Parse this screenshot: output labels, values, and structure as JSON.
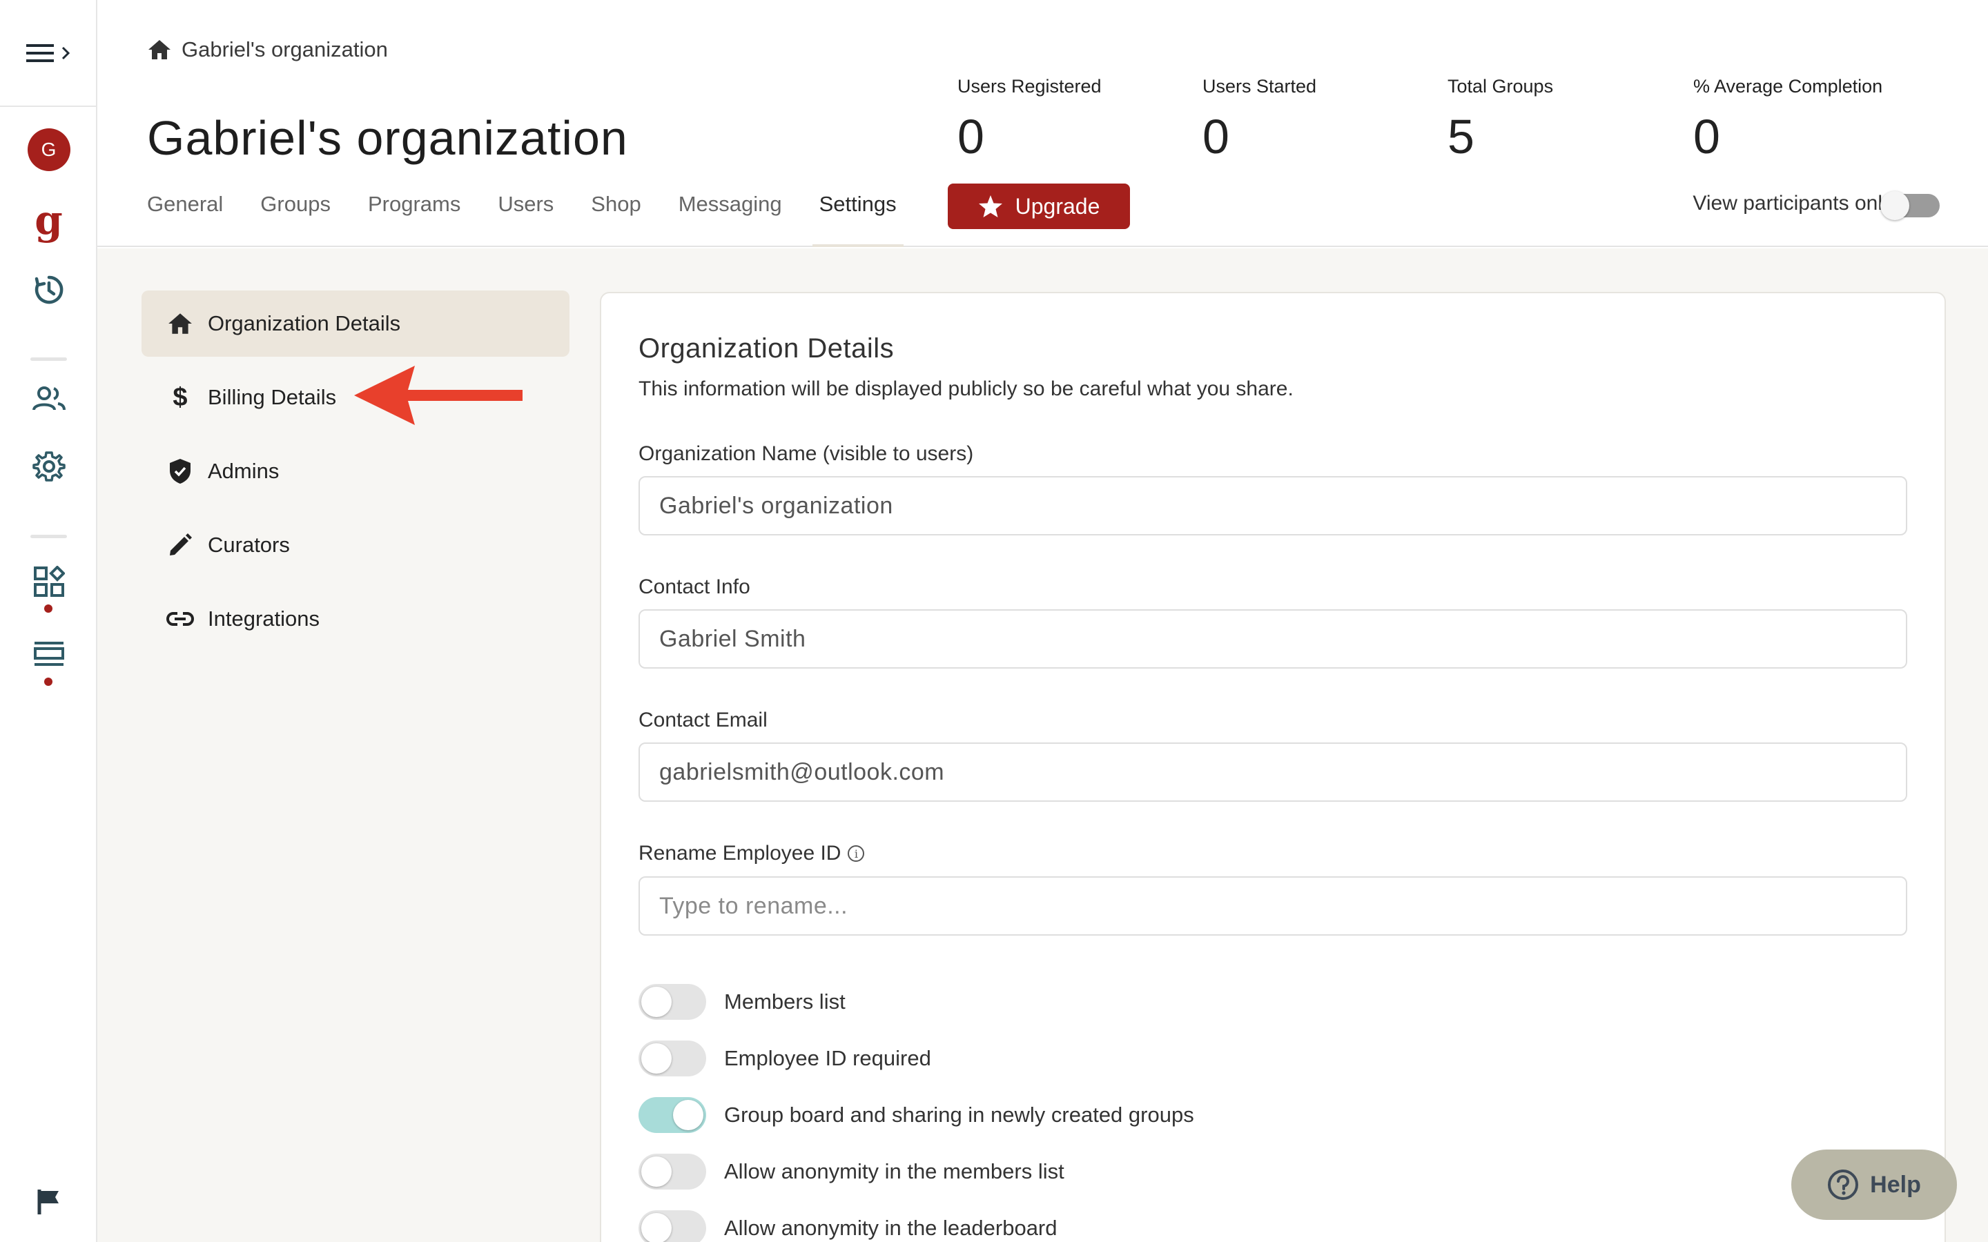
{
  "breadcrumb": {
    "label": "Gabriel's organization"
  },
  "org": {
    "title": "Gabriel's organization"
  },
  "stats": [
    {
      "label": "Users Registered",
      "value": "0"
    },
    {
      "label": "Users Started",
      "value": "0"
    },
    {
      "label": "Total Groups",
      "value": "5"
    },
    {
      "label": "% Average Completion",
      "value": "0"
    }
  ],
  "tabs": [
    {
      "label": "General"
    },
    {
      "label": "Groups"
    },
    {
      "label": "Programs"
    },
    {
      "label": "Users"
    },
    {
      "label": "Shop"
    },
    {
      "label": "Messaging"
    },
    {
      "label": "Settings",
      "active": true
    }
  ],
  "upgrade": {
    "label": "Upgrade"
  },
  "view_participants": {
    "label": "View participants only",
    "on": false
  },
  "avatar": {
    "initial": "G"
  },
  "rail_logo": {
    "letter": "g"
  },
  "settings_nav": [
    {
      "label": "Organization Details",
      "icon": "home-icon",
      "active": true
    },
    {
      "label": "Billing Details",
      "icon": "dollar-icon"
    },
    {
      "label": "Admins",
      "icon": "shield-check-icon"
    },
    {
      "label": "Curators",
      "icon": "pencil-icon"
    },
    {
      "label": "Integrations",
      "icon": "link-icon"
    }
  ],
  "card": {
    "title": "Organization Details",
    "subtitle": "This information will be displayed publicly so be careful what you share.",
    "fields": {
      "org_name": {
        "label": "Organization Name (visible to users)",
        "value": "Gabriel's organization"
      },
      "contact_info": {
        "label": "Contact Info",
        "value": "Gabriel Smith"
      },
      "contact_email": {
        "label": "Contact Email",
        "value": "gabrielsmith@outlook.com"
      },
      "employee_id": {
        "label": "Rename Employee ID",
        "placeholder": "Type to rename..."
      }
    },
    "toggles": [
      {
        "label": "Members list",
        "on": false
      },
      {
        "label": "Employee ID required",
        "on": false
      },
      {
        "label": "Group board and sharing in newly created groups",
        "on": true
      },
      {
        "label": "Allow anonymity in the members list",
        "on": false
      },
      {
        "label": "Allow anonymity in the leaderboard",
        "on": false
      }
    ]
  },
  "help": {
    "label": "Help"
  },
  "colors": {
    "brand": "#a5201c",
    "toggle_on": "#a8dcd9",
    "annotation_arrow": "#e8402c",
    "active_nav_bg": "#ece6dc",
    "content_bg": "#f7f6f3"
  }
}
